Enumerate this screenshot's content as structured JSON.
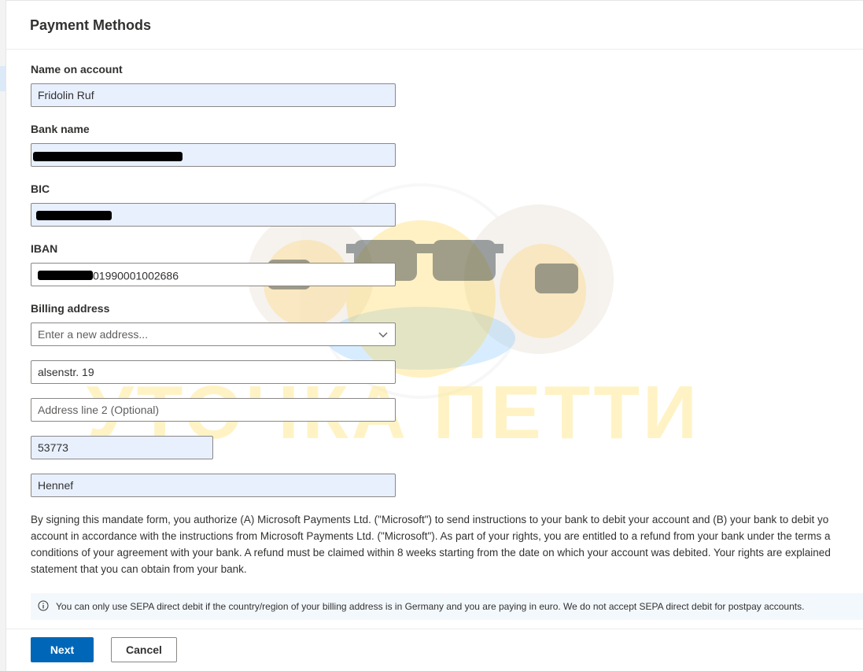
{
  "page": {
    "title": "Payment Methods"
  },
  "form": {
    "name_label": "Name on account",
    "name_value": "Fridolin Ruf",
    "bank_label": "Bank name",
    "bic_label": "BIC",
    "iban_label": "IBAN",
    "iban_value": "01990001002686",
    "billing_label": "Billing address",
    "address_search_placeholder": "Enter a new address...",
    "address_line1": "alsenstr. 19",
    "address_line2_placeholder": "Address line 2 (Optional)",
    "postal_code": "53773",
    "city": "Hennef"
  },
  "mandate": {
    "lines": [
      "By signing this mandate form, you authorize (A) Microsoft Payments Ltd. (\"Microsoft\") to send instructions to your bank to debit your account and (B) your bank to debit yo",
      "account in accordance with the instructions from Microsoft Payments Ltd. (\"Microsoft\"). As part of your rights, you are entitled to a refund from your bank under the terms a",
      "conditions of your agreement with your bank. A refund must be claimed within 8 weeks starting from the date on which your account was debited. Your rights are explained",
      "statement that you can obtain from your bank."
    ]
  },
  "info": {
    "icon": "info-icon",
    "text": "You can only use SEPA direct debit if the country/region of your billing address is in Germany and you are paying in euro. We do not accept SEPA direct debit for postpay accounts."
  },
  "buttons": {
    "next": "Next",
    "cancel": "Cancel"
  },
  "watermark": {
    "text": "УТОЧКА ПЕТТИ"
  },
  "colors": {
    "primary": "#0067b8",
    "autofill": "#e8f0fe",
    "info_bg": "#f3f8fd",
    "watermark": "#ffe680"
  }
}
